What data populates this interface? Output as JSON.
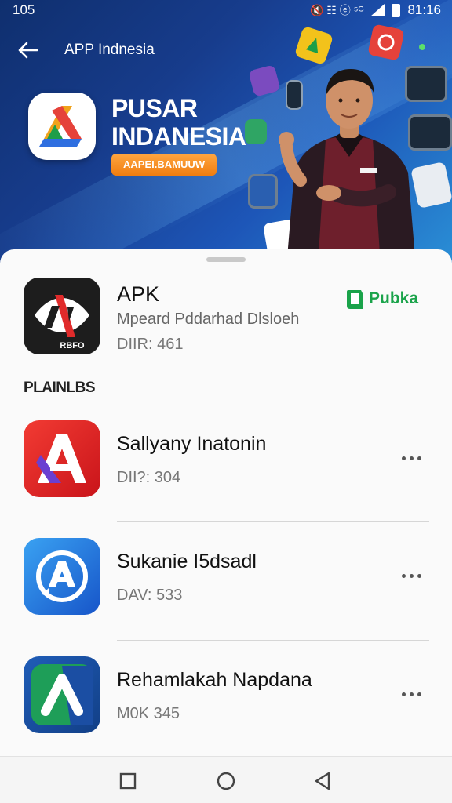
{
  "status_bar": {
    "time_left": "105",
    "time_right": "81:16",
    "indicators": "🔇 ☷ ⓔ ⁵ᴳ"
  },
  "header": {
    "title": "APP Indnesia",
    "back_icon": "arrow-left-icon"
  },
  "hero": {
    "title_line1": "PUSAR",
    "title_line2": "INDANESIA",
    "badge": "AAPEI.BAMUUW"
  },
  "featured": {
    "name": "APK",
    "subtitle": "Mpeard Pddarhad Dlsloeh",
    "meta": "DIIR: 461",
    "publisher": "Pubka",
    "icon_caption": "RBFO"
  },
  "section": {
    "label": "PLAINLBS"
  },
  "apps": [
    {
      "name": "Sallyany Inatonin",
      "meta": "DII?: 304",
      "icon": "red-a-icon"
    },
    {
      "name": "Sukanie I5dsadl",
      "meta": "DAV: 533",
      "icon": "blue-appstore-icon"
    },
    {
      "name": "Rehamlakah Napdana",
      "meta": "M0K 345",
      "icon": "green-arrow-icon"
    }
  ],
  "colors": {
    "hero_dark": "#0f2f6e",
    "hero_light": "#2a8fd6",
    "badge": "#f07d10",
    "publisher_green": "#1aa34a"
  }
}
